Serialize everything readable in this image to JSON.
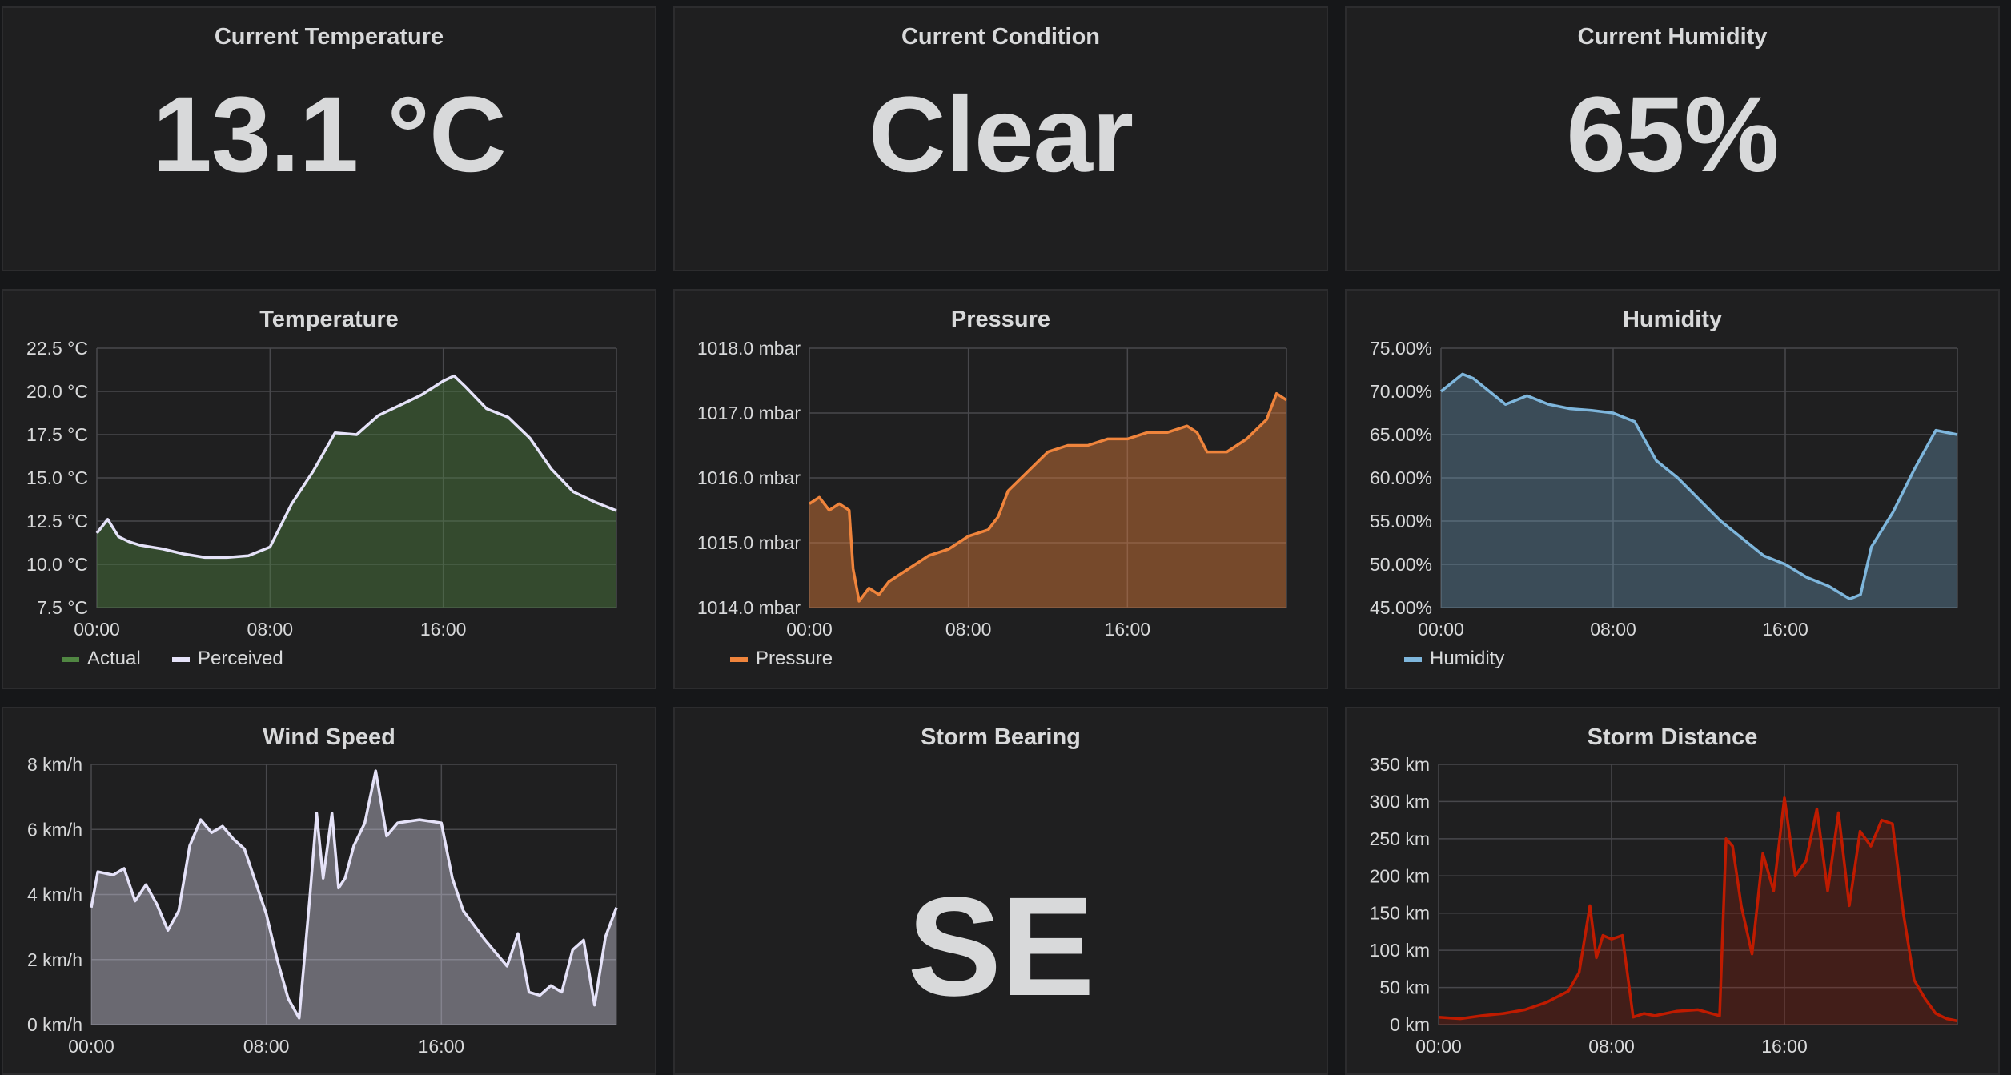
{
  "stats": {
    "temperature": {
      "title": "Current Temperature",
      "value": "13.1 °C"
    },
    "condition": {
      "title": "Current Condition",
      "value": "Clear"
    },
    "humidity": {
      "title": "Current Humidity",
      "value": "65%"
    },
    "bearing": {
      "title": "Storm Bearing",
      "value": "SE"
    }
  },
  "colors": {
    "actual": "#508642",
    "perceived": "#e5e2f8",
    "pressure": "#ef843c",
    "humidity": "#7eb6dc",
    "wind": "#e5e2f8",
    "storm": "#bf1b00",
    "grid": "#48484c"
  },
  "charts": {
    "temperature": {
      "title": "Temperature",
      "legend": [
        "Actual",
        "Perceived"
      ],
      "ticks_y": [
        "22.5 °C",
        "20.0 °C",
        "17.5 °C",
        "15.0 °C",
        "12.5 °C",
        "10.0 °C",
        "7.5 °C"
      ],
      "ticks_x": [
        "00:00",
        "08:00",
        "16:00"
      ]
    },
    "pressure": {
      "title": "Pressure",
      "legend": [
        "Pressure"
      ],
      "ticks_y": [
        "1018.0 mbar",
        "1017.0 mbar",
        "1016.0 mbar",
        "1015.0 mbar",
        "1014.0 mbar"
      ],
      "ticks_x": [
        "00:00",
        "08:00",
        "16:00"
      ]
    },
    "humidity": {
      "title": "Humidity",
      "legend": [
        "Humidity"
      ],
      "ticks_y": [
        "75.00%",
        "70.00%",
        "65.00%",
        "60.00%",
        "55.00%",
        "50.00%",
        "45.00%"
      ],
      "ticks_x": [
        "00:00",
        "08:00",
        "16:00"
      ]
    },
    "wind": {
      "title": "Wind Speed",
      "ticks_y": [
        "8 km/h",
        "6 km/h",
        "4 km/h",
        "2 km/h",
        "0 km/h"
      ],
      "ticks_x": [
        "00:00",
        "08:00",
        "16:00"
      ]
    },
    "storm": {
      "title": "Storm Distance",
      "ticks_y": [
        "350 km",
        "300 km",
        "250 km",
        "200 km",
        "150 km",
        "100 km",
        "50 km",
        "0 km"
      ],
      "ticks_x": [
        "00:00",
        "08:00",
        "16:00"
      ]
    }
  },
  "chart_data": [
    {
      "type": "area",
      "title": "Temperature",
      "ylim": [
        7.5,
        22.5
      ],
      "xlim": [
        0,
        24
      ],
      "grid": true,
      "legend_position": "bottom-left",
      "x": [
        0,
        0.5,
        1,
        1.5,
        2,
        3,
        4,
        5,
        6,
        7,
        8,
        9,
        10,
        11,
        12,
        13,
        14,
        15,
        16,
        16.5,
        17,
        18,
        19,
        20,
        21,
        22,
        23,
        24
      ],
      "series": [
        {
          "name": "Actual",
          "values": [
            11.8,
            12.6,
            11.6,
            11.3,
            11.1,
            10.9,
            10.6,
            10.4,
            10.4,
            10.5,
            11.0,
            13.5,
            15.4,
            17.6,
            17.5,
            18.6,
            19.2,
            19.8,
            20.6,
            20.9,
            20.3,
            19.0,
            18.5,
            17.3,
            15.5,
            14.2,
            13.6,
            13.1
          ]
        },
        {
          "name": "Perceived",
          "values": [
            11.8,
            12.6,
            11.6,
            11.3,
            11.1,
            10.9,
            10.6,
            10.4,
            10.4,
            10.5,
            11.0,
            13.5,
            15.4,
            17.6,
            17.5,
            18.6,
            19.2,
            19.8,
            20.6,
            20.9,
            20.3,
            19.0,
            18.5,
            17.3,
            15.5,
            14.2,
            13.6,
            13.1
          ]
        }
      ]
    },
    {
      "type": "area",
      "title": "Pressure",
      "ylim": [
        1014.0,
        1018.0
      ],
      "xlim": [
        0,
        24
      ],
      "grid": true,
      "legend_position": "bottom-left",
      "x": [
        0,
        0.5,
        1,
        1.5,
        2,
        2.2,
        2.5,
        3,
        3.5,
        4,
        5,
        6,
        7,
        8,
        9,
        9.5,
        10,
        11,
        12,
        13,
        14,
        15,
        16,
        17,
        18,
        19,
        19.5,
        20,
        21,
        22,
        23,
        23.5,
        24
      ],
      "series": [
        {
          "name": "Pressure",
          "values": [
            1015.6,
            1015.7,
            1015.5,
            1015.6,
            1015.5,
            1014.6,
            1014.1,
            1014.3,
            1014.2,
            1014.4,
            1014.6,
            1014.8,
            1014.9,
            1015.1,
            1015.2,
            1015.4,
            1015.8,
            1016.1,
            1016.4,
            1016.5,
            1016.5,
            1016.6,
            1016.6,
            1016.7,
            1016.7,
            1016.8,
            1016.7,
            1016.4,
            1016.4,
            1016.6,
            1016.9,
            1017.3,
            1017.2
          ]
        }
      ]
    },
    {
      "type": "area",
      "title": "Humidity",
      "ylim": [
        45,
        75
      ],
      "xlim": [
        0,
        24
      ],
      "grid": true,
      "legend_position": "bottom-left",
      "x": [
        0,
        0.5,
        1,
        1.5,
        2,
        3,
        4,
        5,
        6,
        7,
        8,
        9,
        10,
        11,
        12,
        13,
        14,
        15,
        16,
        17,
        18,
        19,
        19.5,
        20,
        21,
        22,
        23,
        24
      ],
      "series": [
        {
          "name": "Humidity",
          "values": [
            70,
            71,
            72,
            71.5,
            70.5,
            68.5,
            69.5,
            68.5,
            68.0,
            67.8,
            67.5,
            66.5,
            62.0,
            60.0,
            57.5,
            55.0,
            53.0,
            51.0,
            50.0,
            48.5,
            47.5,
            46.0,
            46.5,
            52.0,
            56.0,
            61.0,
            65.5,
            65.0
          ]
        }
      ]
    },
    {
      "type": "area",
      "title": "Wind Speed",
      "ylim": [
        0,
        8
      ],
      "xlim": [
        0,
        24
      ],
      "grid": true,
      "x": [
        0,
        0.3,
        1,
        1.5,
        2,
        2.5,
        3,
        3.5,
        4,
        4.5,
        5,
        5.5,
        6,
        6.5,
        7,
        7.5,
        8,
        8.5,
        9,
        9.5,
        10,
        10.3,
        10.6,
        11,
        11.3,
        11.6,
        12,
        12.5,
        13,
        13.5,
        14,
        15,
        16,
        16.5,
        17,
        18,
        19,
        19.5,
        20,
        20.5,
        21,
        21.5,
        22,
        22.5,
        23,
        23.5,
        24
      ],
      "series": [
        {
          "name": "Wind Speed",
          "values": [
            3.6,
            4.7,
            4.6,
            4.8,
            3.8,
            4.3,
            3.7,
            2.9,
            3.5,
            5.5,
            6.3,
            5.9,
            6.1,
            5.7,
            5.4,
            4.4,
            3.4,
            2.0,
            0.8,
            0.2,
            4.0,
            6.5,
            4.5,
            6.5,
            4.2,
            4.5,
            5.5,
            6.2,
            7.8,
            5.8,
            6.2,
            6.3,
            6.2,
            4.5,
            3.5,
            2.6,
            1.8,
            2.8,
            1.0,
            0.9,
            1.2,
            1.0,
            2.3,
            2.6,
            0.6,
            2.7,
            3.6
          ]
        }
      ]
    },
    {
      "type": "area",
      "title": "Storm Distance",
      "ylim": [
        0,
        350
      ],
      "xlim": [
        0,
        24
      ],
      "grid": true,
      "x": [
        0,
        1,
        2,
        3,
        4,
        5,
        6,
        6.5,
        7,
        7.3,
        7.6,
        8,
        8.5,
        9,
        9.5,
        10,
        11,
        12,
        13,
        13.3,
        13.6,
        14,
        14.5,
        15,
        15.5,
        16,
        16.5,
        17,
        17.5,
        18,
        18.5,
        19,
        19.5,
        20,
        20.5,
        21,
        21.5,
        22,
        22.5,
        23,
        23.5,
        24
      ],
      "series": [
        {
          "name": "Storm Distance",
          "values": [
            10,
            8,
            12,
            15,
            20,
            30,
            45,
            70,
            160,
            90,
            120,
            115,
            120,
            10,
            15,
            12,
            18,
            20,
            12,
            250,
            240,
            160,
            95,
            230,
            180,
            305,
            200,
            220,
            290,
            180,
            285,
            160,
            260,
            240,
            275,
            270,
            150,
            60,
            35,
            15,
            8,
            5
          ]
        }
      ]
    }
  ]
}
